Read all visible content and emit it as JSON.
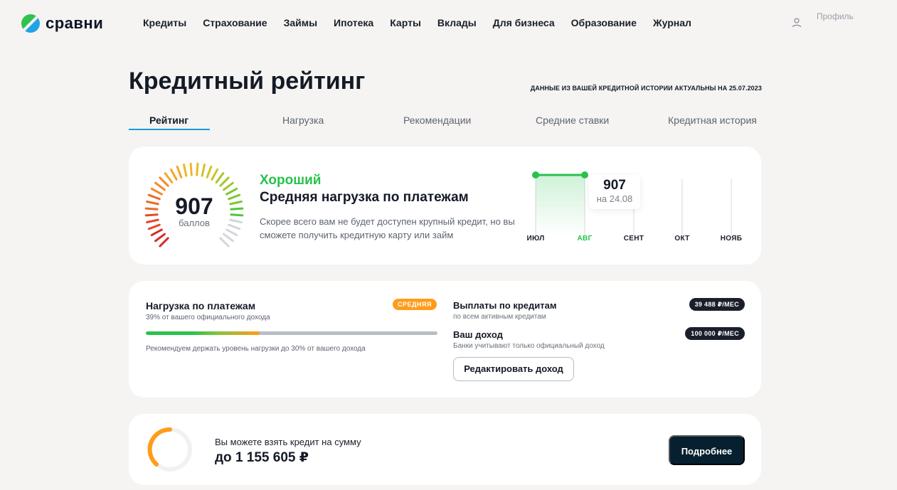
{
  "brand": {
    "name": "сравни",
    "colors": {
      "green": "#27c24c",
      "blue": "#1a9be0",
      "orange": "#ff9c1a",
      "dark": "#06202f"
    }
  },
  "nav": [
    "Кредиты",
    "Страхование",
    "Займы",
    "Ипотека",
    "Карты",
    "Вклады",
    "Для бизнеса",
    "Образование",
    "Журнал"
  ],
  "profile": {
    "label": "Профиль",
    "icon": "user-icon"
  },
  "page": {
    "title": "Кредитный рейтинг",
    "actual_date": "ДАННЫЕ ИЗ ВАШЕЙ КРЕДИТНОЙ ИСТОРИИ АКТУАЛЬНЫ НА 25.07.2023"
  },
  "tabs": [
    {
      "label": "Рейтинг",
      "active": true
    },
    {
      "label": "Нагрузка",
      "active": false
    },
    {
      "label": "Рекомендации",
      "active": false
    },
    {
      "label": "Средние ставки",
      "active": false
    },
    {
      "label": "Кредитная история",
      "active": false
    }
  ],
  "score": {
    "value": "907",
    "unit": "баллов",
    "rating_label": "Хороший",
    "title": "Средняя нагрузка по платежам",
    "description": "Скорее всего вам не будет доступен крупный кредит, но вы сможете получить кредитную карту или займ"
  },
  "history": {
    "months": [
      "ИЮЛ",
      "АВГ",
      "СЕНТ",
      "ОКТ",
      "НОЯБ"
    ],
    "current_month": "АВГ",
    "tooltip_value": "907",
    "tooltip_date": "на 24.08"
  },
  "load": {
    "title": "Нагрузка по платежам",
    "subtitle": "39% от вашего официального дохода",
    "level_badge": "СРЕДНЯЯ",
    "percent": 39,
    "advice": "Рекомендуем держать уровень нагрузки до 30% от вашего дохода",
    "payments_title": "Выплаты по кредитам",
    "payments_sub": "по всем активным кредитам",
    "payments_value": "39 488 ₽/МЕС",
    "income_title": "Ваш доход",
    "income_sub": "Банки учитывают только официальный доход",
    "income_value": "100 000 ₽/МЕС",
    "edit_button": "Редактировать доход"
  },
  "credit": {
    "label": "Вы можете взять кредит на сумму",
    "amount": "до 1 155 605 ₽",
    "more_button": "Подробнее"
  }
}
